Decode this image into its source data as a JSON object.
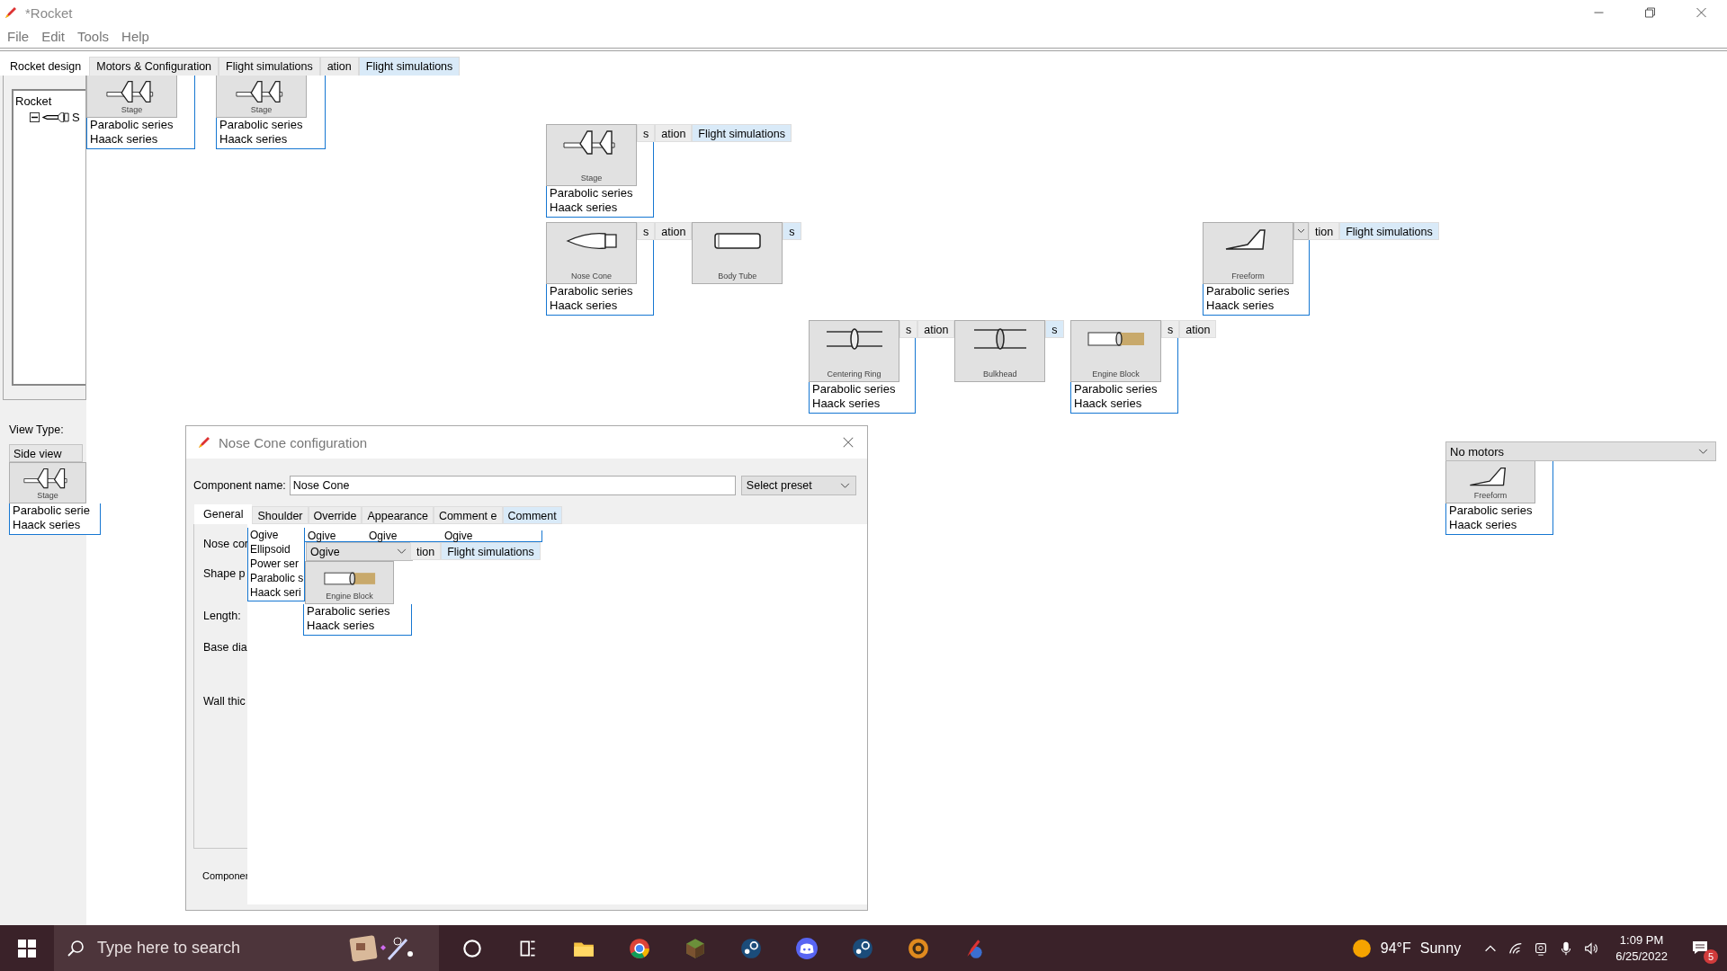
{
  "window": {
    "title": "*Rocket"
  },
  "menu": [
    "File",
    "Edit",
    "Tools",
    "Help"
  ],
  "main_tabs": [
    {
      "label": "Rocket design",
      "selected": true,
      "highlighted": false
    },
    {
      "label": "Motors & Configuration",
      "selected": false,
      "highlighted": false
    },
    {
      "label": "Flight simulations",
      "selected": false,
      "highlighted": false
    },
    {
      "label": "ation",
      "selected": false,
      "highlighted": false
    },
    {
      "label": "Flight simulations",
      "selected": false,
      "highlighted": true
    }
  ],
  "tree": {
    "label": "Rocket",
    "children": [
      {
        "label": "S",
        "expanded": true
      }
    ]
  },
  "view_type": {
    "label": "View Type:",
    "value": "Side view"
  },
  "motor_select": {
    "value": "No motors"
  },
  "fragments": [
    {
      "items": [
        {
          "kind": "tile",
          "label": "Stage"
        }
      ],
      "list": [
        "Parabolic series",
        "Haack series"
      ]
    },
    {
      "items": [
        {
          "kind": "tile",
          "label": "Stage"
        }
      ],
      "list": [
        "Parabolic series",
        "Haack series"
      ]
    },
    {
      "items": [
        {
          "kind": "tile",
          "label": "Stage"
        },
        {
          "kind": "tab",
          "label": "s",
          "highlighted": false
        },
        {
          "kind": "tab",
          "label": "ation",
          "highlighted": false
        },
        {
          "kind": "tab",
          "label": "Flight simulations",
          "highlighted": true
        }
      ],
      "list": [
        "Parabolic series",
        "Haack series"
      ]
    },
    {
      "items": [
        {
          "kind": "tile",
          "label": "Nose Cone"
        },
        {
          "kind": "tab",
          "label": "s",
          "highlighted": false
        },
        {
          "kind": "tab",
          "label": "ation",
          "highlighted": false
        },
        {
          "kind": "tile",
          "label": "Body Tube"
        },
        {
          "kind": "tab",
          "label": "s",
          "highlighted": true
        }
      ],
      "list": [
        "Parabolic series",
        "Haack series"
      ]
    },
    {
      "items": [
        {
          "kind": "tile",
          "label": "Freeform"
        },
        {
          "kind": "arrow"
        },
        {
          "kind": "tab",
          "label": "tion",
          "highlighted": false
        },
        {
          "kind": "tab",
          "label": "Flight simulations",
          "highlighted": true
        }
      ],
      "list": [
        "Parabolic series",
        "Haack series"
      ]
    },
    {
      "items": [
        {
          "kind": "tile",
          "label": "Centering Ring"
        },
        {
          "kind": "tab",
          "label": "s",
          "highlighted": false
        },
        {
          "kind": "tab",
          "label": "ation",
          "highlighted": false
        },
        {
          "kind": "tile",
          "label": "Bulkhead"
        },
        {
          "kind": "tab",
          "label": "s",
          "highlighted": true
        }
      ],
      "list": [
        "Parabolic series",
        "Haack series"
      ]
    },
    {
      "items": [
        {
          "kind": "tile",
          "label": "Engine Block"
        },
        {
          "kind": "tab",
          "label": "s",
          "highlighted": false
        },
        {
          "kind": "tab",
          "label": "ation",
          "highlighted": false
        }
      ],
      "list": [
        "Parabolic series",
        "Haack series"
      ]
    },
    {
      "items": [
        {
          "kind": "tile",
          "label": "Stage"
        }
      ],
      "list": [
        "Parabolic serie",
        "Haack series"
      ]
    },
    {
      "items": [
        {
          "kind": "tile",
          "label": "Freeform"
        }
      ],
      "list": [
        "Parabolic series",
        "Haack series"
      ]
    }
  ],
  "dialog": {
    "title": "Nose Cone configuration",
    "name_label": "Component name:",
    "name_value": "Nose Cone",
    "preset": "Select preset",
    "tabs": [
      {
        "label": "General",
        "selected": true,
        "highlighted": false
      },
      {
        "label": "Shoulder",
        "selected": false,
        "highlighted": false
      },
      {
        "label": "Override",
        "selected": false,
        "highlighted": false
      },
      {
        "label": "Appearance",
        "selected": false,
        "highlighted": false
      },
      {
        "label": "Comment e",
        "selected": false,
        "highlighted": false
      },
      {
        "label": "Comment",
        "selected": false,
        "highlighted": true
      }
    ],
    "labels": [
      "Nose cor",
      "Shape p",
      "Length:",
      "Base dia",
      "Wall thic"
    ],
    "footer_label": "Componer",
    "glitch": {
      "strip": [
        "Ogive",
        "Ogive",
        "Ogive"
      ],
      "list": [
        "Ogive",
        "Ellipsoid",
        "Power ser",
        "Parabolic s",
        "Haack seri"
      ],
      "dropdown": "Ogive",
      "tabs": [
        {
          "label": "tion",
          "highlighted": false
        },
        {
          "label": "Flight simulations",
          "highlighted": true
        }
      ],
      "tile": "Engine Block",
      "tile_list": [
        "Parabolic series",
        "Haack series"
      ]
    }
  },
  "taskbar": {
    "search_placeholder": "Type here to search",
    "temperature": "94°F",
    "weather": "Sunny",
    "time": "1:09 PM",
    "date": "6/25/2022",
    "notifications": "5"
  }
}
